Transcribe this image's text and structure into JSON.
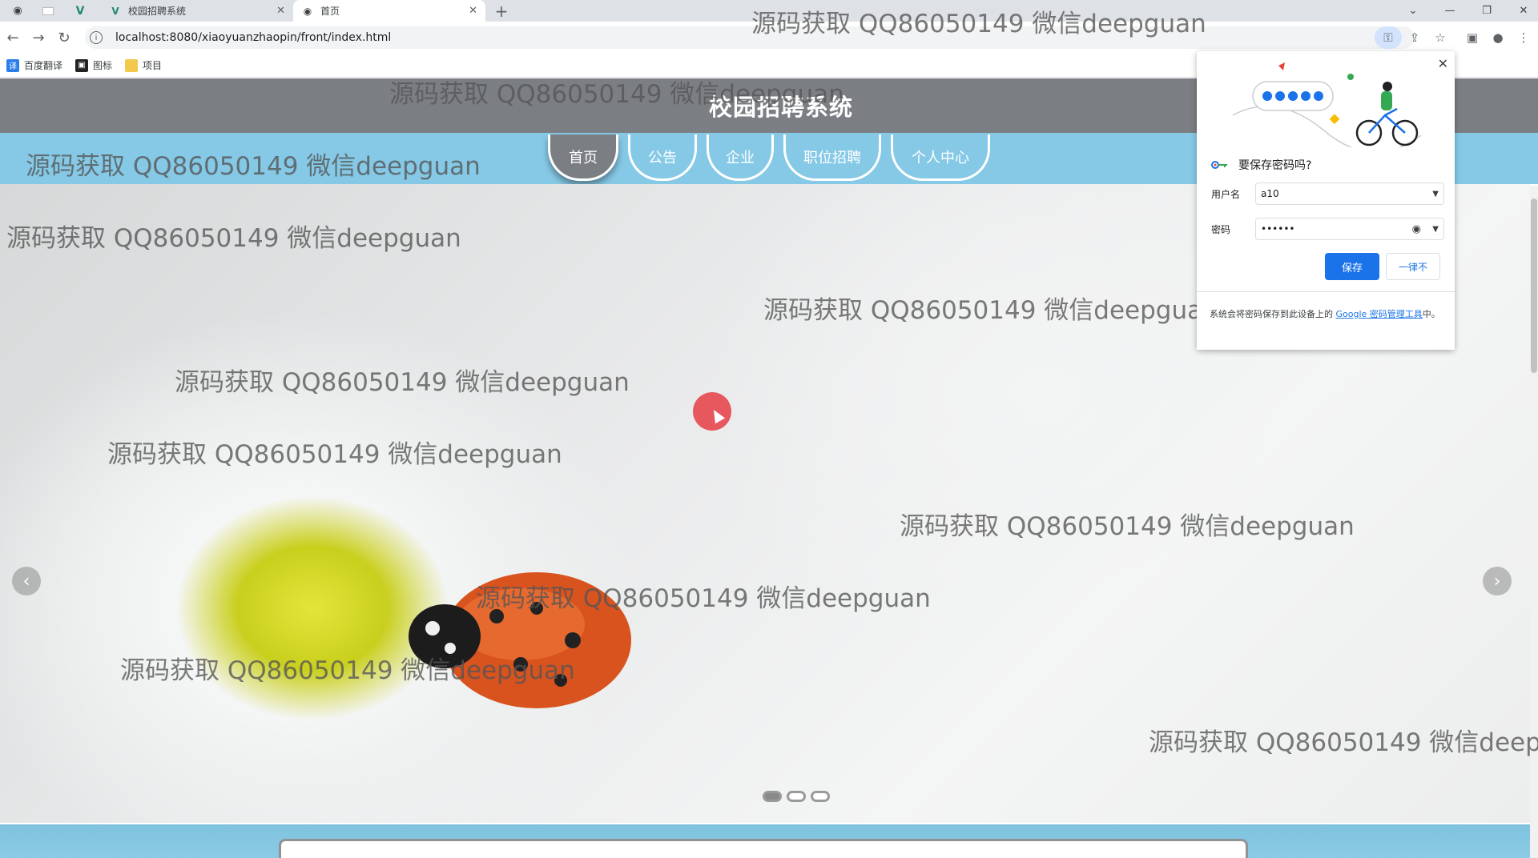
{
  "browser": {
    "tabs": [
      {
        "label": "",
        "icon": "globe-icon"
      },
      {
        "label": "",
        "icon": "blank-page-icon"
      },
      {
        "label": "",
        "icon": "v-logo-icon"
      },
      {
        "label": "校园招聘系统",
        "icon": "v-logo-icon"
      },
      {
        "label": "首页",
        "icon": "globe-icon"
      }
    ],
    "url": "localhost:8080/xiaoyuanzhaopin/front/index.html",
    "bookmarks": [
      {
        "label": "百度翻译",
        "icon": "translate-icon",
        "color": "#2b7de9"
      },
      {
        "label": "图标",
        "icon": "image-icon",
        "color": "#222222"
      },
      {
        "label": "项目",
        "icon": "folder-icon",
        "color": "#f2c94c"
      }
    ]
  },
  "site": {
    "title": "校园招聘系统",
    "nav": [
      "首页",
      "公告",
      "企业",
      "职位招聘",
      "个人中心"
    ],
    "header_color": "#7b7f84",
    "nav_band_color": "#86c9e6",
    "carousel": {
      "slides": 3,
      "active_index": 0
    }
  },
  "watermark": {
    "text": "源码获取 QQ86050149 微信deepguan",
    "text_cut": "源码获取 QQ86050149 微信deepgu"
  },
  "password_dialog": {
    "title": "要保存密码吗?",
    "username_label": "用户名",
    "username_value": "a10",
    "password_label": "密码",
    "password_value": "••••••",
    "save_label": "保存",
    "never_label": "一律不",
    "footer_text": "系统会将密码保存到此设备上的",
    "footer_link": "Google 密码管理工具",
    "footer_suffix": "中。"
  }
}
